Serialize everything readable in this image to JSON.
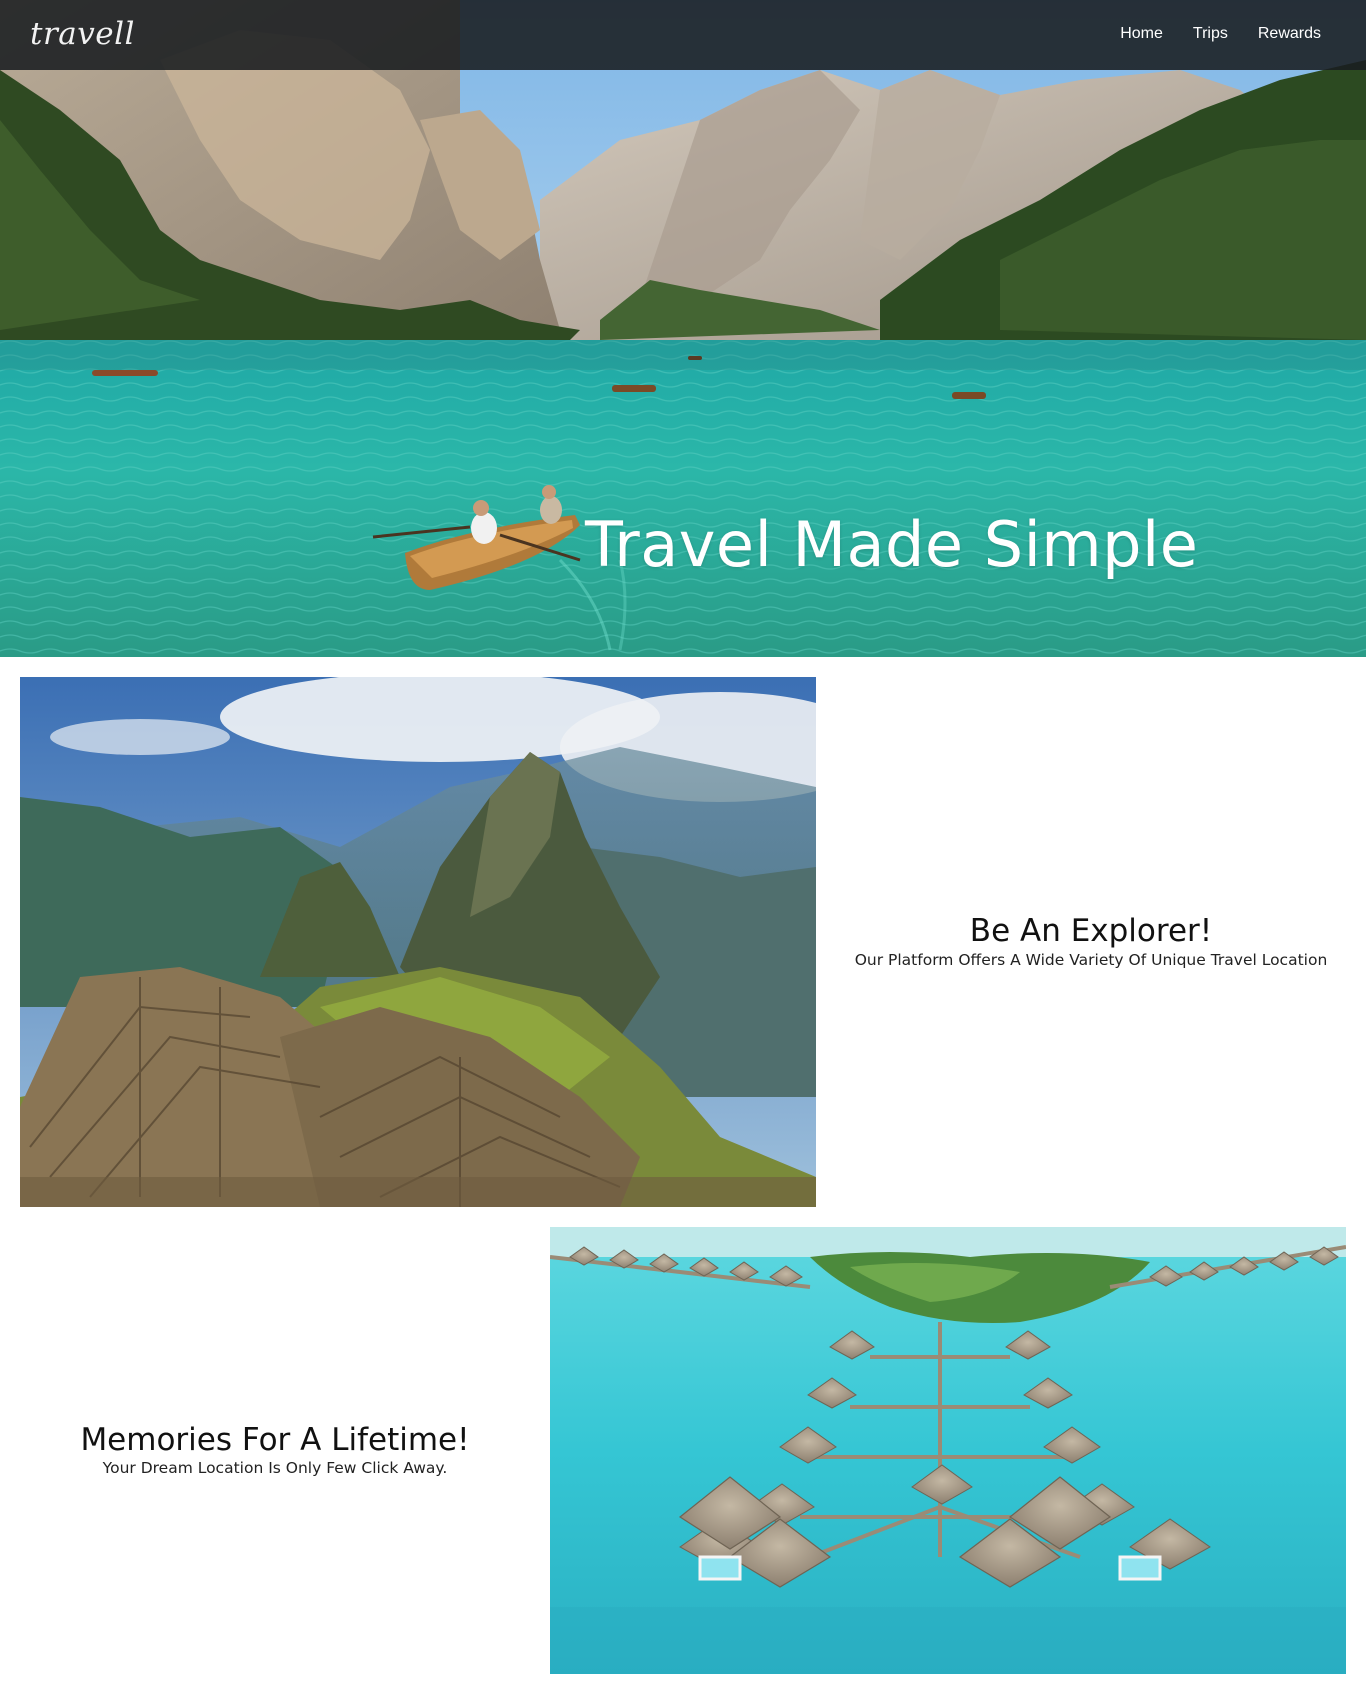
{
  "navbar": {
    "brand": "travell",
    "links": [
      {
        "label": "Home"
      },
      {
        "label": "Trips"
      },
      {
        "label": "Rewards"
      }
    ]
  },
  "hero": {
    "title": "Travel Made Simple",
    "image": "mountain-lake-rowboat-photo"
  },
  "features": [
    {
      "heading": "Be An Explorer!",
      "subtitle": "Our Platform Offers A Wide Variety Of Unique Travel Location",
      "image": "machu-picchu-photo"
    },
    {
      "heading": "Memories For A Lifetime!",
      "subtitle": "Your Dream Location Is Only Few Click Away.",
      "image": "overwater-bungalows-photo"
    }
  ],
  "colors": {
    "navbar_bg": "#1c1f23",
    "lake": "#2bb3a8",
    "lagoon": "#3fd0dd",
    "text_dark": "#111111"
  }
}
